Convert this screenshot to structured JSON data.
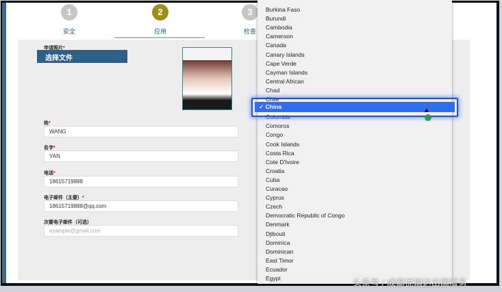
{
  "steps": [
    {
      "num": "1",
      "label": "安全"
    },
    {
      "num": "2",
      "label": "应用"
    },
    {
      "num": "3",
      "label": "检查"
    }
  ],
  "form": {
    "photo_label": "申请照片",
    "choose_file": "选择文件",
    "surname_label": "姓",
    "surname": "WANG",
    "given_label": "名字",
    "given": "YAN",
    "phone_label": "电话",
    "phone": "18615719888",
    "email_label": "电子邮件（主要）",
    "email": "18615719888@qq.com",
    "email2_label": "次要电子邮件（可选）",
    "email2_placeholder": "example@gmail.com",
    "required_mark": "*"
  },
  "dropdown": {
    "options": [
      "Burkina Faso",
      "Burundi",
      "Cambodia",
      "Cameroon",
      "Canada",
      "Canary Islands",
      "Cape Verde",
      "Cayman Islands",
      "Central African",
      "Chad",
      "Chile",
      "China",
      "Colombia",
      "Comoros",
      "Congo",
      "Cook Islands",
      "Costa Rica",
      "Cote D'Ivoire",
      "Croatia",
      "Cuba",
      "Curacao",
      "Cyprus",
      "Czech",
      "Democratic Republic of Congo",
      "Denmark",
      "Djibouti",
      "Dominica",
      "Dominican",
      "East Timor",
      "Ecuador",
      "Egypt"
    ],
    "selected": "China",
    "check": "✓"
  },
  "watermark": "头条号 / 成都优瑞达出国服务",
  "colors": {
    "accent": "#2b6189",
    "active_step": "#9c8f1a",
    "highlight": "#2f6ef0"
  }
}
